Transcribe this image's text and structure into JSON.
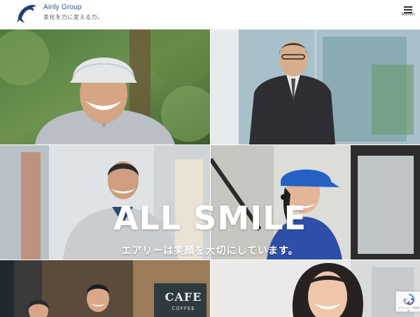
{
  "header": {
    "brand": "Airily Group",
    "tagline": "変化を力に変える力。",
    "menu_label": "MENU"
  },
  "hero": {
    "title": "ALL SMILE",
    "subtitle": "エアリーは笑顔を大切にしています。"
  },
  "tiles": {
    "cafe_sign_top": "CAFE",
    "cafe_sign_bottom": "COFFEE"
  },
  "recaptcha": {
    "terms": "プライバシー · 利用規約"
  },
  "colors": {
    "brand_blue": "#1f3f78",
    "menu_text": "#333333",
    "hero_text": "#ffffff"
  },
  "icons": {
    "logo": "dolphin-logo-icon",
    "menu": "hamburger-menu-icon",
    "recaptcha": "recaptcha-icon"
  }
}
